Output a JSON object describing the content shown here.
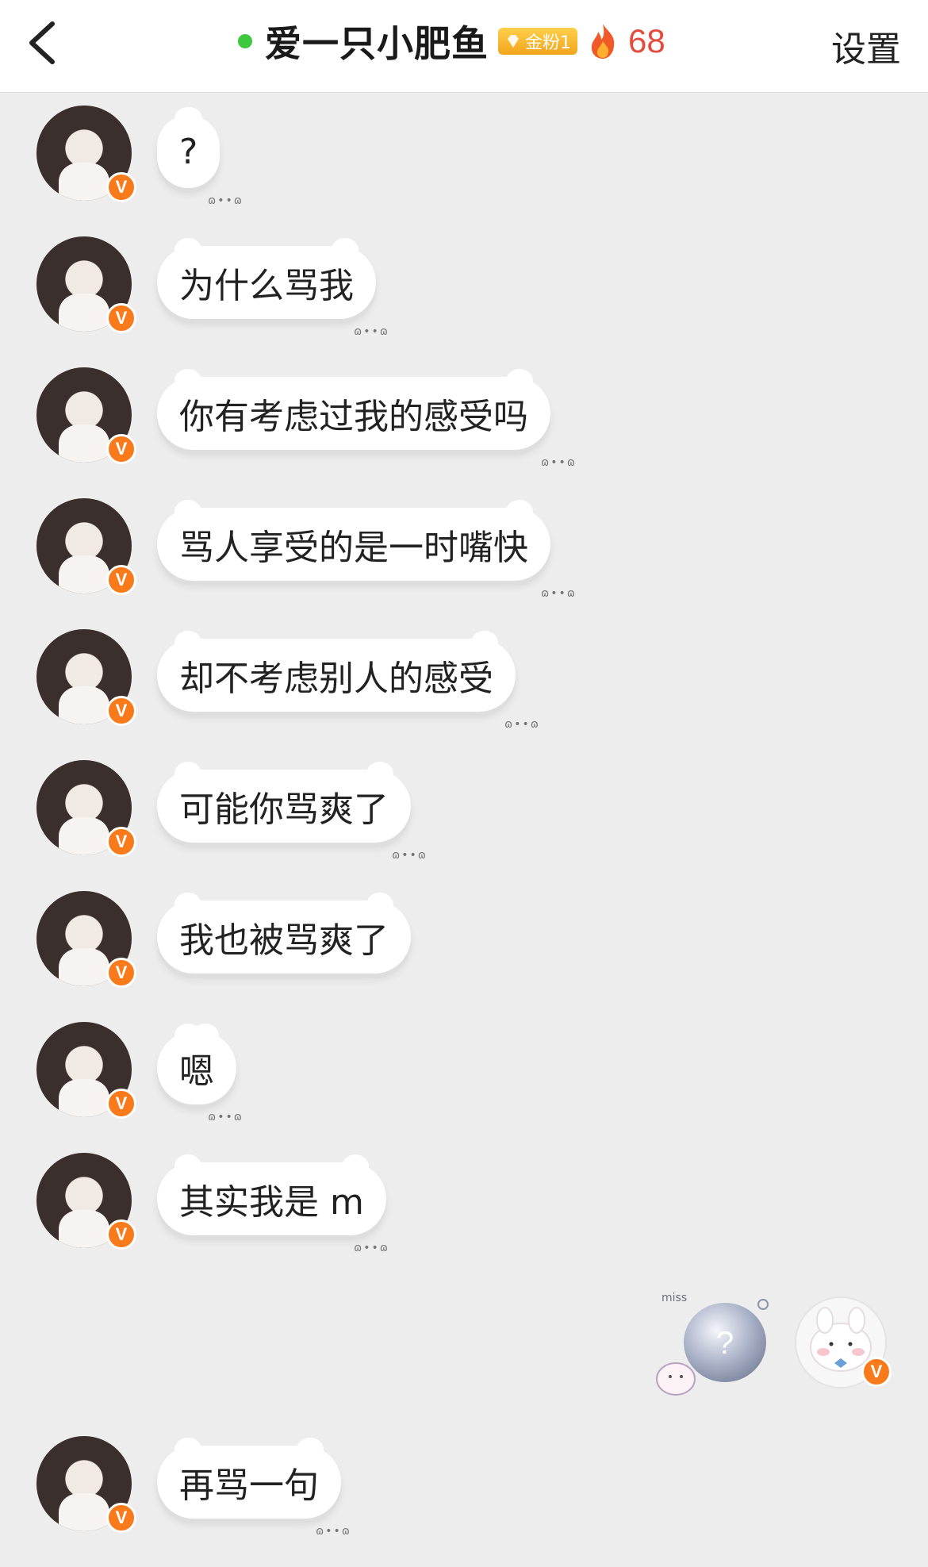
{
  "header": {
    "title": "爱一只小肥鱼",
    "badge_label": "金粉1",
    "fire_count": "68",
    "settings_label": "设置",
    "online_color": "#3ec83e",
    "count_color": "#e44b3c"
  },
  "messages": [
    {
      "text": "?"
    },
    {
      "text": "为什么骂我"
    },
    {
      "text": "你有考虑过我的感受吗"
    },
    {
      "text": "骂人享受的是一时嘴快"
    },
    {
      "text": "却不考虑别人的感受"
    },
    {
      "text": "可能你骂爽了"
    },
    {
      "text": "我也被骂爽了"
    },
    {
      "text": "嗯"
    },
    {
      "text": "其实我是 m"
    },
    {
      "text": "再骂一句"
    }
  ],
  "sticker": {
    "text_top": "miss",
    "text_center": "?"
  },
  "verified_badge": "V"
}
